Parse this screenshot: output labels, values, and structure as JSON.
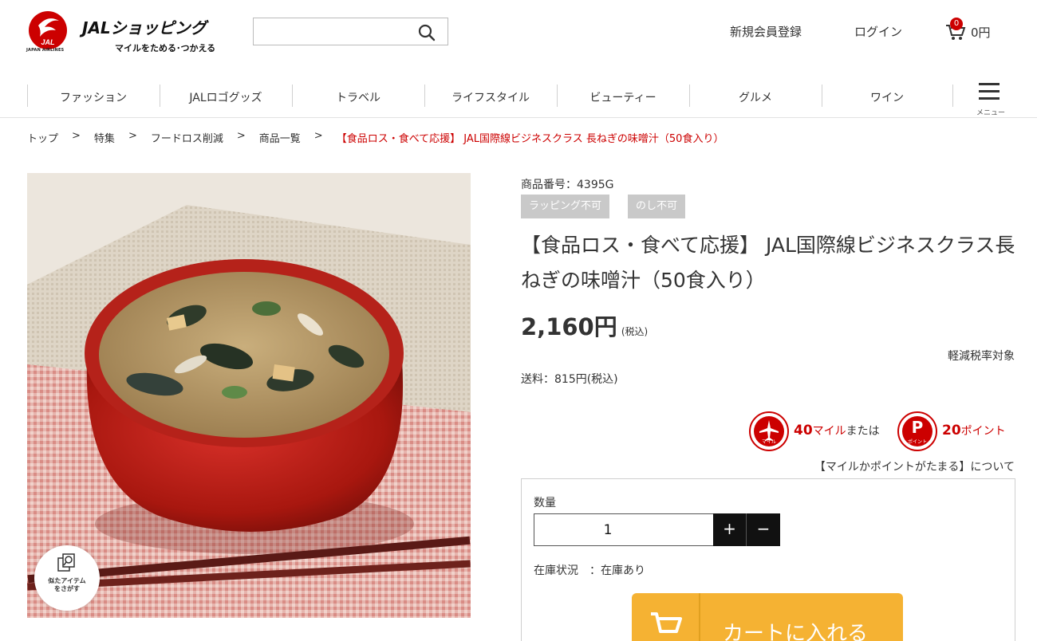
{
  "header": {
    "logo_title": "JALショッピング",
    "logo_tagline": "マイルをためる･つかえる",
    "logo_brand": "JAL",
    "logo_airline": "JAPAN AIRLINES",
    "search": {
      "value": "",
      "placeholder": ""
    },
    "register_label": "新規会員登録",
    "login_label": "ログイン",
    "cart": {
      "count": "0",
      "amount": "0円"
    }
  },
  "nav": {
    "items": [
      {
        "label": "ファッション"
      },
      {
        "label": "JALロゴグッズ"
      },
      {
        "label": "トラベル"
      },
      {
        "label": "ライフスタイル"
      },
      {
        "label": "ビューティー"
      },
      {
        "label": "グルメ"
      },
      {
        "label": "ワイン"
      }
    ],
    "menu_label": "メニュー"
  },
  "breadcrumb": {
    "items": [
      {
        "label": "トップ"
      },
      {
        "label": "特集"
      },
      {
        "label": "フードロス削減"
      },
      {
        "label": "商品一覧"
      }
    ],
    "separator": ">",
    "current": "【食品ロス・食べて応援】 JAL国際線ビジネスクラス 長ねぎの味噌汁（50食入り）"
  },
  "product": {
    "code": "商品番号：4395G",
    "tags": [
      "ラッピング不可",
      "のし不可"
    ],
    "title": "【食品ロス・食べて応援】 JAL国際線ビジネスクラス長ねぎの味噌汁（50食入り）",
    "price": "2,160円",
    "price_tax": "(税込)",
    "reduced_tax": "軽減税率対象",
    "shipping": "送料：815円(税込)",
    "miles": {
      "mile_icon_caption": "マイル",
      "mile_value": "40",
      "mile_unit": "マイル",
      "connector": "または",
      "point_icon_letter": "P",
      "point_icon_caption": "ポイント",
      "point_value": "20",
      "point_unit": "ポイント"
    },
    "about_link": "【マイルかポイントがたまる】について",
    "similar_label": "似たアイテム\nをさがす",
    "quantity": {
      "label": "数量",
      "value": "1",
      "plus": "+",
      "minus": "−"
    },
    "stock": "在庫状況　：在庫あり",
    "add_to_cart": "カートに入れる"
  },
  "colors": {
    "accent_red": "#cc0000",
    "cart_button": "#f5b233",
    "tag_gray": "#c9c9c9"
  }
}
